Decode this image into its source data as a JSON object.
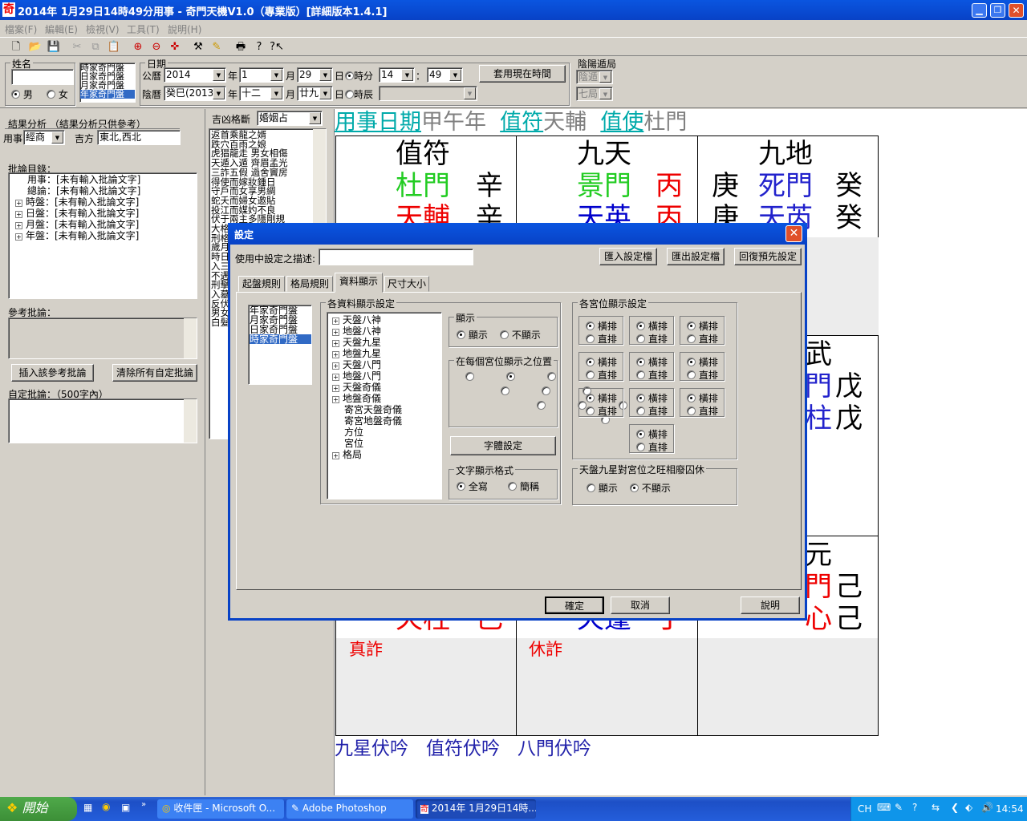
{
  "window": {
    "title": "2014年 1月29日14時49分用事 - 奇門天機V1.0（專業版）[詳細版本1.4.1]",
    "app_icon": "奇"
  },
  "menu": [
    "檔案(F)",
    "編輯(E)",
    "檢視(V)",
    "工具(T)",
    "說明(H)"
  ],
  "toolbar": [
    "new-icon",
    "open-icon",
    "save-icon",
    "cut-icon",
    "copy-icon",
    "paste-icon",
    "zoom-in-icon",
    "zoom-out-icon",
    "compass-icon",
    "tool-icon",
    "eraser-icon",
    "print-icon",
    "help-icon",
    "whatsthis-icon"
  ],
  "top": {
    "name_label": "姓名",
    "name_value": "",
    "male": "男",
    "female": "女",
    "chart_types": [
      "時家奇門盤",
      "日家奇門盤",
      "月家奇門盤",
      "年家奇門盤"
    ],
    "date_label": "日期",
    "gregorian": "公曆",
    "year": "2014",
    "year_u": "年",
    "month": "1",
    "month_u": "月",
    "day": "29",
    "day_u": "日",
    "time_u": "時分",
    "hour": "14",
    "colon": "：",
    "minute": "49",
    "lunar": "陰曆",
    "lunar_year": "癸巳(2013",
    "lunar_month": "十二",
    "lunar_day": "廿九",
    "shichen": "時辰",
    "use_now": "套用現在時間",
    "yinyang_label": "陰陽遁局",
    "yin": "陰遁",
    "ju": "七局"
  },
  "left": {
    "analysis_label": "結果分析  （結果分析只供參考）",
    "matter_label": "用事",
    "matter": "經商",
    "dir_label": "吉方",
    "dir": "東北,西北",
    "comment_dir_label": "批論目錄：",
    "tree": [
      {
        "t": "用事：[未有輸入批論文字]",
        "p": false
      },
      {
        "t": "總論：[未有輸入批論文字]",
        "p": false
      },
      {
        "t": "時盤：[未有輸入批論文字]",
        "p": true
      },
      {
        "t": "日盤：[未有輸入批論文字]",
        "p": true
      },
      {
        "t": "月盤：[未有輸入批論文字]",
        "p": true
      },
      {
        "t": "年盤：[未有輸入批論文字]",
        "p": true
      }
    ],
    "ref_label": "參考批論：",
    "insert_btn": "插入該參考批論",
    "clear_btn": "清除所有自定批論",
    "custom_label": "自定批論：（500字內）"
  },
  "mid": {
    "label": "吉凶格斷",
    "select": "婚姻占",
    "items": [
      "返首乘龍之婿",
      "跌穴百雨之娘",
      "虎猖龍走  男女相傷",
      "天遁入遁  齊眉孟光",
      "三詐五假  過舍竇房",
      "得使而嫁妝鍾日",
      "守戶而女享男綢",
      "蛇夭而婦女邀貼",
      "投江而媒妁不良",
      "伏于兩主多隱剛規",
      "大格",
      "刑格",
      "歲月",
      "時日",
      "入三",
      "不遇",
      "刑擊",
      "入墓",
      "反伏",
      "男女",
      "白髮"
    ]
  },
  "board": {
    "header": {
      "a": "用事日期",
      "b": "甲午年",
      "c": "值符",
      "d": "天輔",
      "e": "值使",
      "f": "杜門"
    },
    "c1": {
      "god": "值符",
      "door": "杜門",
      "stem": "辛",
      "star": "天輔",
      "stem2": "辛"
    },
    "c2": {
      "god": "九天",
      "door": "景門",
      "stem": "丙",
      "star": "天英",
      "stem2": "丙"
    },
    "c3": {
      "god": "九地",
      "stem0": "庚",
      "door": "死門",
      "stem": "癸",
      "stem0b": "庚",
      "star": "天芮",
      "stem2": "癸"
    },
    "r2": {
      "top": "武",
      "door": "門",
      "stem": "戊",
      "star": "柱",
      "stem2": "戊"
    },
    "r3": {
      "top": "元",
      "door": "門",
      "stem": "己",
      "star": "心",
      "stem2": "己",
      "c1star": "天柱",
      "c1stem": "己",
      "c2star": "天蓬",
      "c2stem": "丁"
    },
    "r3labels": {
      "a": "真詐",
      "b": "休詐"
    },
    "footer": {
      "a": "九星伏吟",
      "b": "值符伏吟",
      "c": "八門伏吟"
    }
  },
  "dialog": {
    "title": "設定",
    "desc_label": "使用中設定之描述:",
    "desc_value": "",
    "import": "匯入設定檔",
    "export": "匯出設定檔",
    "restore": "回復預先設定",
    "tabs": [
      "起盤規則",
      "格局規則",
      "資料顯示",
      "尺寸大小"
    ],
    "chart_list": [
      "年家奇門盤",
      "月家奇門盤",
      "日家奇門盤",
      "時家奇門盤"
    ],
    "data_group": "各資料顯示設定",
    "data_tree": [
      {
        "t": "天盤八神",
        "p": true
      },
      {
        "t": "地盤八神",
        "p": true
      },
      {
        "t": "天盤九星",
        "p": true
      },
      {
        "t": "地盤九星",
        "p": true
      },
      {
        "t": "天盤八門",
        "p": true
      },
      {
        "t": "地盤八門",
        "p": true
      },
      {
        "t": "天盤奇儀",
        "p": true
      },
      {
        "t": "地盤奇儀",
        "p": true
      },
      {
        "t": "寄宮天盤奇儀",
        "p": false
      },
      {
        "t": "寄宮地盤奇儀",
        "p": false
      },
      {
        "t": "方位",
        "p": false
      },
      {
        "t": "宮位",
        "p": false
      },
      {
        "t": "格局",
        "p": true
      }
    ],
    "show_group": "顯示",
    "show": "顯示",
    "hide": "不顯示",
    "pos_group": "在每個宮位顯示之位置",
    "font_btn": "字體設定",
    "fmt_group": "文字顯示格式",
    "trad": "全寫",
    "simp": "簡稱",
    "palace_group": "各宮位顯示設定",
    "h": "橫排",
    "v": "直排",
    "star_group": "天盤九星對宮位之旺相廢囚休",
    "star_show": "顯示",
    "star_hide": "不顯示",
    "ok": "確定",
    "cancel": "取消",
    "help": "說明"
  },
  "taskbar": {
    "start": "開始",
    "tasks": [
      "收件匣 - Microsoft O...",
      "Adobe Photoshop",
      "2014年 1月29日14時..."
    ],
    "lang": "CH",
    "time": "14:54"
  }
}
